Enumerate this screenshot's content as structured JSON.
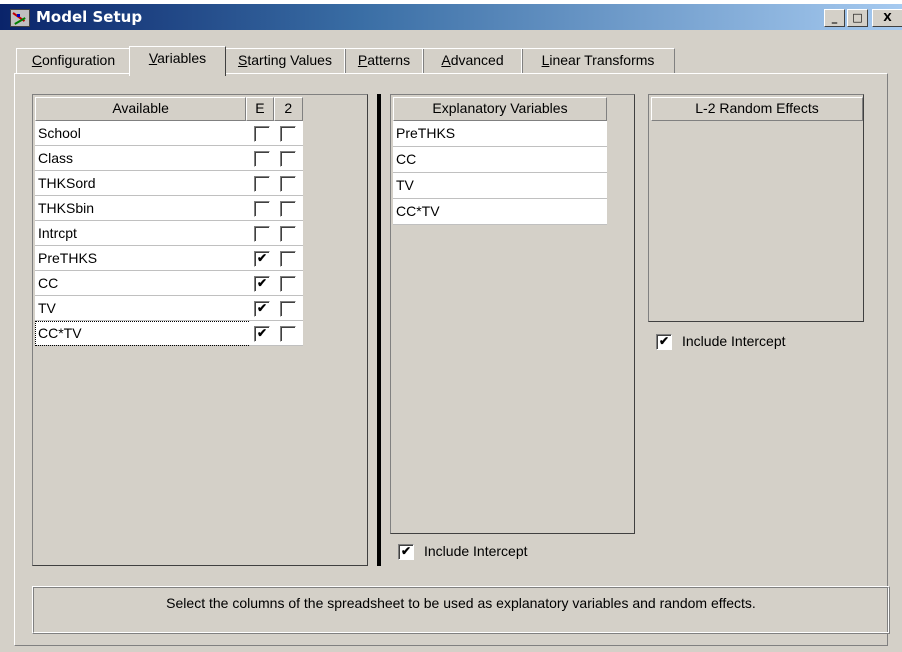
{
  "window": {
    "title": "Model Setup",
    "minimize_label": "_",
    "maximize_label": "□",
    "close_label": "X"
  },
  "tabs": [
    {
      "label": "Configuration",
      "accel": "C",
      "rest": "onfiguration"
    },
    {
      "label": "Variables",
      "accel": "V",
      "rest": "ariables"
    },
    {
      "label": "Starting Values",
      "accel": "S",
      "rest": "tarting Values"
    },
    {
      "label": "Patterns",
      "accel": "P",
      "rest": "atterns"
    },
    {
      "label": "Advanced",
      "accel": "A",
      "rest": "dvanced"
    },
    {
      "label": "Linear Transforms",
      "accel": "L",
      "rest": "inear Transforms"
    }
  ],
  "available": {
    "header": "Available",
    "col_e": "E",
    "col_2": "2",
    "rows": [
      {
        "name": "School",
        "e": false,
        "two": false
      },
      {
        "name": "Class",
        "e": false,
        "two": false
      },
      {
        "name": "THKSord",
        "e": false,
        "two": false
      },
      {
        "name": "THKSbin",
        "e": false,
        "two": false
      },
      {
        "name": "Intrcpt",
        "e": false,
        "two": false
      },
      {
        "name": "PreTHKS",
        "e": true,
        "two": false
      },
      {
        "name": "CC",
        "e": true,
        "two": false
      },
      {
        "name": "TV",
        "e": true,
        "two": false
      },
      {
        "name": "CC*TV",
        "e": true,
        "two": false
      }
    ]
  },
  "explanatory": {
    "header": "Explanatory Variables",
    "rows": [
      "PreTHKS",
      "CC",
      "TV",
      "CC*TV"
    ],
    "include_intercept_label": "Include Intercept",
    "include_intercept": true
  },
  "random_effects": {
    "header": "L-2 Random Effects",
    "rows": [],
    "include_intercept_label": "Include Intercept",
    "include_intercept": true
  },
  "status_text": "Select the columns of the spreadsheet to be used as explanatory variables and random effects.",
  "check_glyph": "✔"
}
